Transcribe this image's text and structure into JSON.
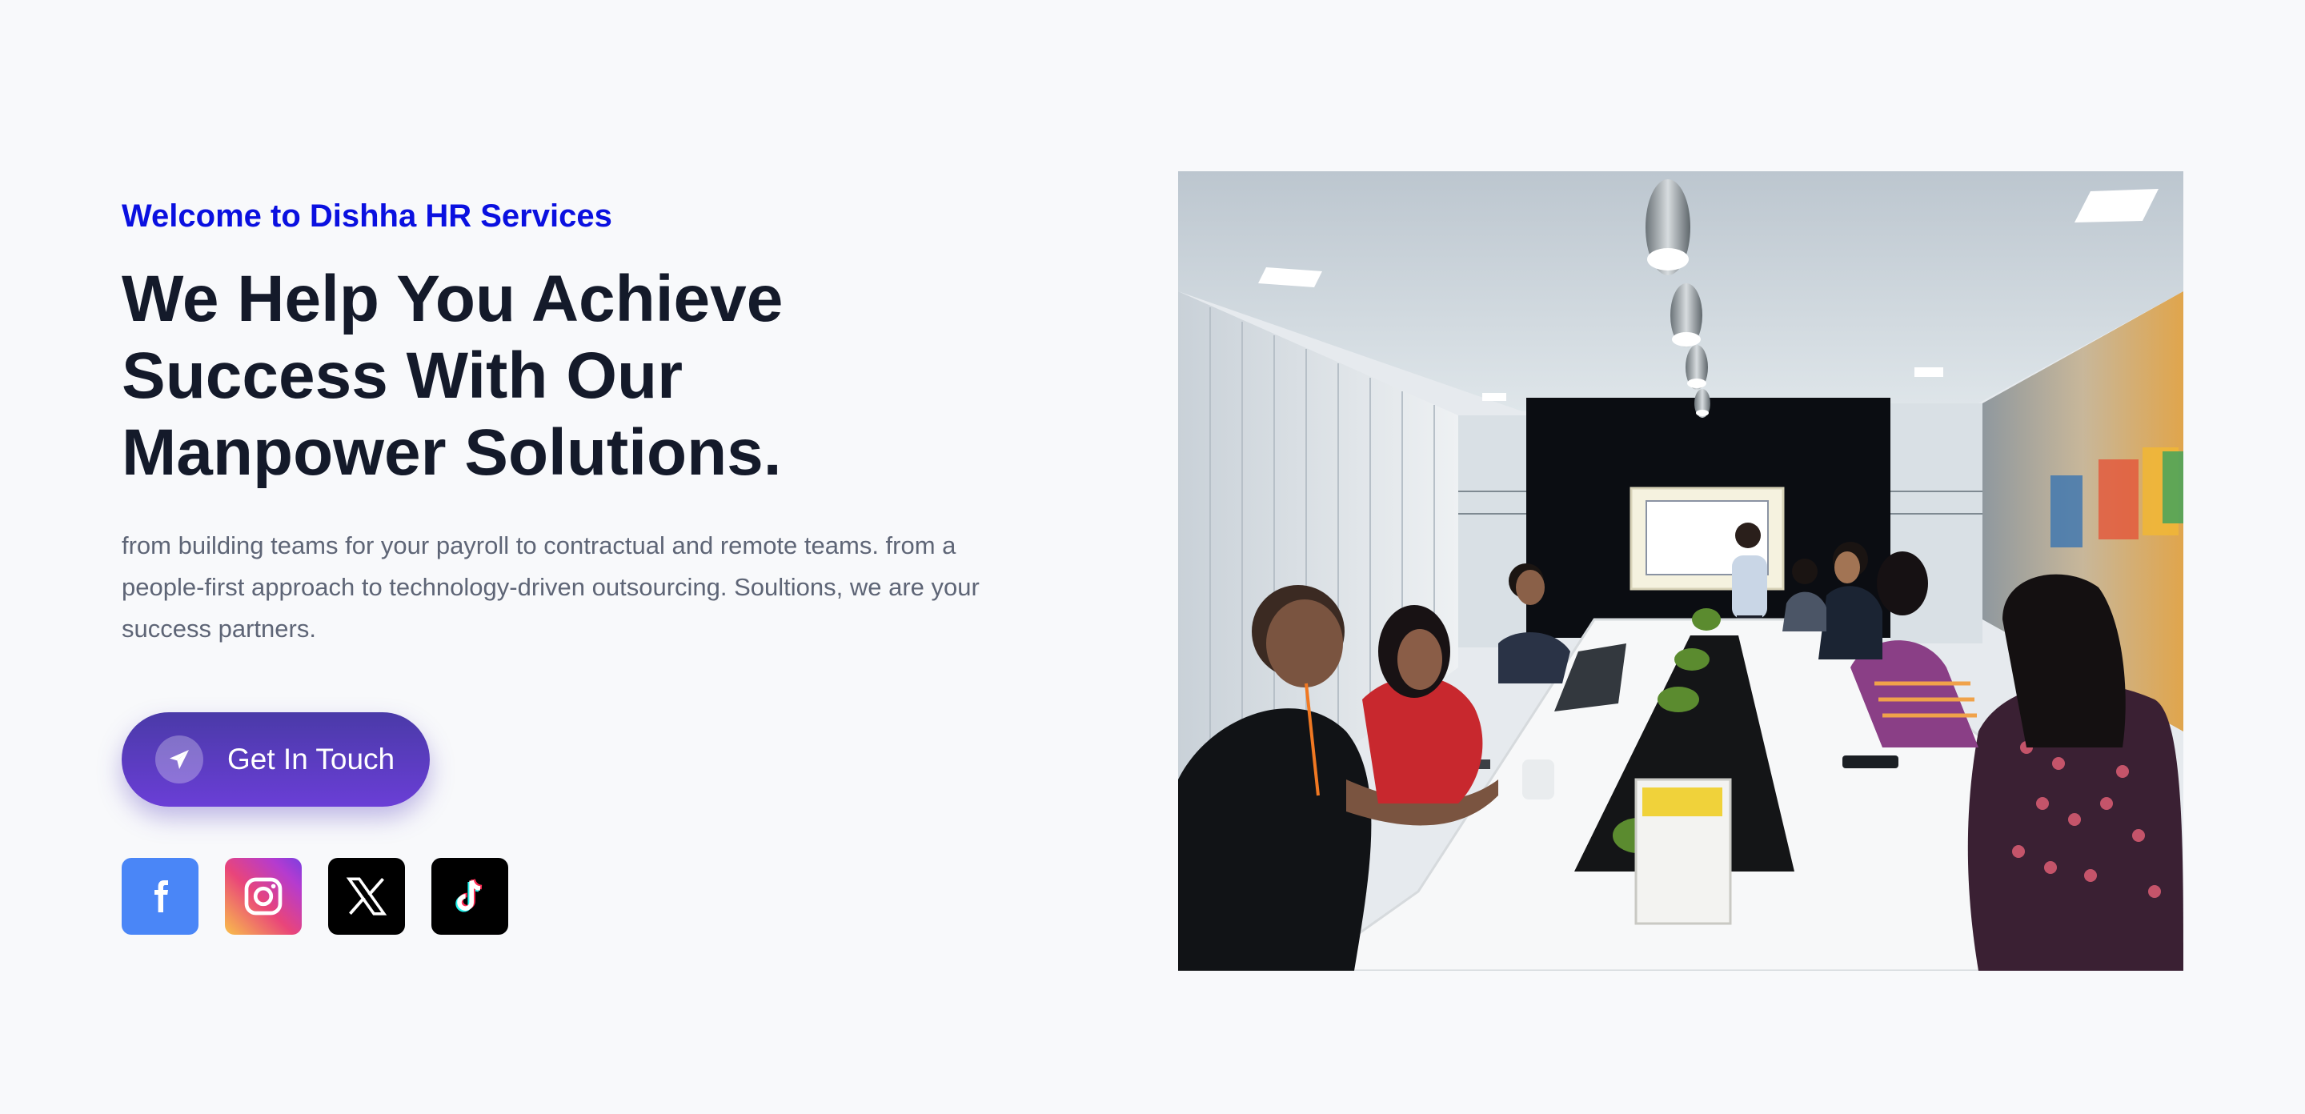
{
  "hero": {
    "eyebrow": "Welcome to Dishha HR Services",
    "headline": "We Help You Achieve Success With Our Manpower Solutions.",
    "description": "from building teams for your payroll to contractual and remote teams. from a people-first approach to technology-driven outsourcing. Soultions, we are your success partners.",
    "cta": {
      "label": "Get In Touch",
      "icon": "paper-plane-icon"
    }
  },
  "socials": [
    {
      "name": "facebook",
      "icon": "facebook-icon",
      "color": "#4a86f7"
    },
    {
      "name": "instagram",
      "icon": "instagram-icon",
      "color": "#e9457a"
    },
    {
      "name": "x",
      "icon": "x-twitter-icon",
      "color": "#000000"
    },
    {
      "name": "tiktok",
      "icon": "tiktok-icon",
      "color": "#000000"
    }
  ],
  "image": {
    "subject": "meeting-room-photo"
  },
  "colors": {
    "accent": "#0a10e0",
    "heading": "#141a2a",
    "body": "#5e6576",
    "button": "#5b3cc4",
    "background": "#f8f9fb"
  }
}
